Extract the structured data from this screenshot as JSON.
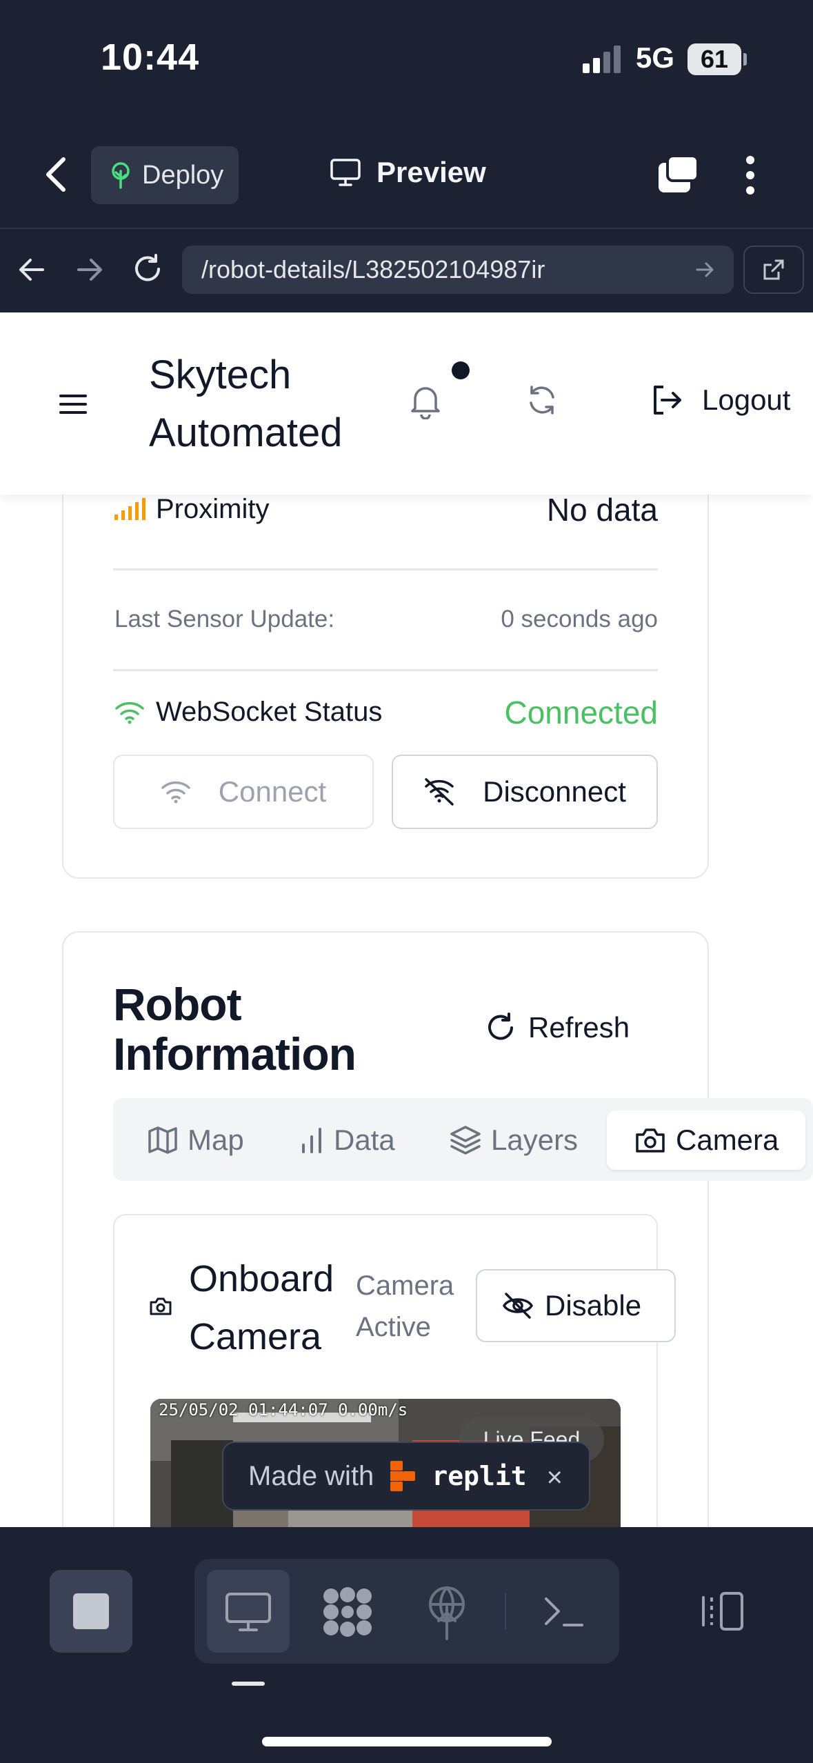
{
  "status_bar": {
    "time": "10:44",
    "network": "5G",
    "battery": "61"
  },
  "replit_header": {
    "deploy_label": "Deploy",
    "preview_label": "Preview"
  },
  "url_bar": {
    "url": "/robot-details/L382502104987ir"
  },
  "app_header": {
    "brand_line1": "Skytech",
    "brand_line2": "Automated",
    "logout_label": "Logout"
  },
  "sensor_card": {
    "proximity_label": "Proximity",
    "proximity_value": "No data",
    "last_update_label": "Last Sensor Update:",
    "last_update_value": "0 seconds ago",
    "websocket_label": "WebSocket Status",
    "websocket_value": "Connected",
    "connect_label": "Connect",
    "disconnect_label": "Disconnect"
  },
  "robot_info": {
    "title_line1": "Robot",
    "title_line2": "Information",
    "refresh_label": "Refresh",
    "tabs": [
      {
        "label": "Map",
        "icon": "map-icon"
      },
      {
        "label": "Data",
        "icon": "bar-chart-icon"
      },
      {
        "label": "Layers",
        "icon": "layers-icon"
      },
      {
        "label": "Camera",
        "icon": "camera-icon",
        "active": true
      }
    ],
    "camera": {
      "title_line1": "Onboard",
      "title_line2": "Camera",
      "status_line1": "Camera",
      "status_line2": "Active",
      "disable_label": "Disable",
      "feed_timestamp": "25/05/02 01:44:07 0.00m/s",
      "live_badge": "Live Feed"
    }
  },
  "made_with": {
    "prefix": "Made with",
    "brand": "replit",
    "close": "×"
  },
  "colors": {
    "dark_bg": "#1c2231",
    "connected_green": "#4ac062",
    "proximity_orange": "#f59e0b"
  }
}
